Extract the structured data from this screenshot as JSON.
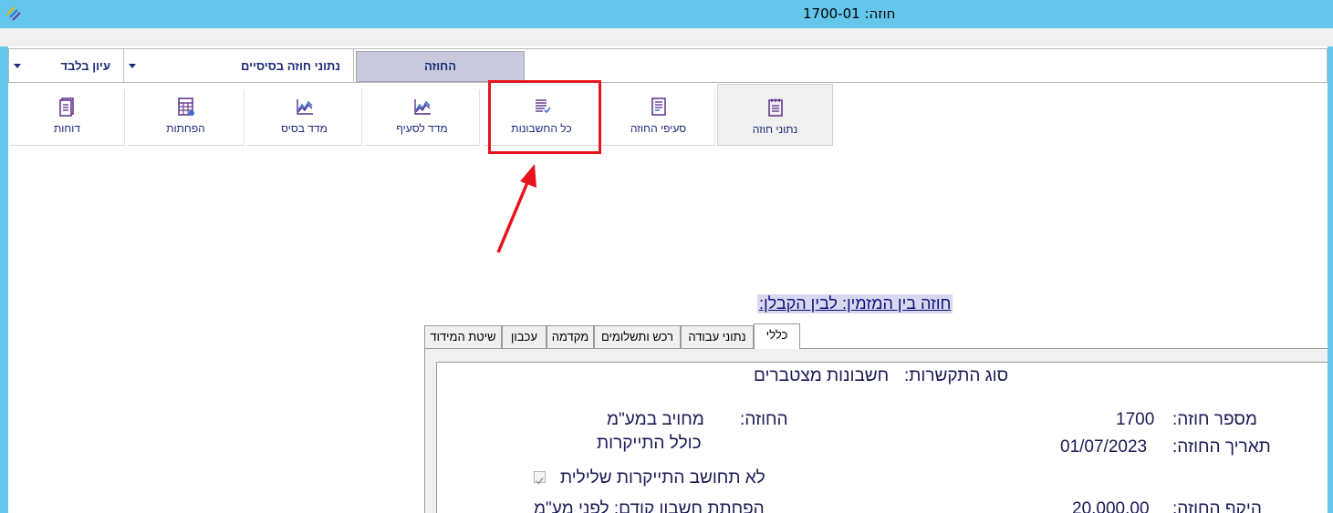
{
  "window": {
    "title": "חוזה: 1700-01"
  },
  "menubar": {
    "view_only": "עיון בלבד",
    "basic_data": "נתוני חוזה בסיסיים",
    "contract_tab": "החוזה"
  },
  "ribbon": {
    "items": [
      {
        "label": "נתוני חוזה",
        "icon": "contract-doc-icon",
        "active": true
      },
      {
        "label": "סעיפי החוזה",
        "icon": "clauses-doc-icon"
      },
      {
        "label": "כל החשבונות",
        "icon": "invoices-list-icon"
      },
      {
        "label": "מדד לסעיף",
        "icon": "line-chart-icon"
      },
      {
        "label": "מדד בסיס",
        "icon": "line-chart-icon"
      },
      {
        "label": "הפחתות",
        "icon": "calculator-icon"
      },
      {
        "label": "דוחות",
        "icon": "reports-icon"
      }
    ]
  },
  "annotation": {
    "highlight_color": "#e8141d"
  },
  "main": {
    "parties_title": "חוזה בין המזמין:   לבין הקבלן:"
  },
  "tabs": [
    "כללי",
    "נתוני עבודה",
    "רכש ותשלומים",
    "מקדמה",
    "עכבון",
    "שיטת המידוד"
  ],
  "general": {
    "link_type_label": "סוג התקשרות:",
    "link_type_value": "חשבונות מצטברים",
    "contract_no_label": "מספר חוזה:",
    "contract_no_value": "1700",
    "contract_date_label": "תאריך החוזה:",
    "contract_date_value": "01/07/2023",
    "contract_label": "החוזה:",
    "contract_value_1": "מחויב במע\"מ",
    "contract_value_2": "כולל התייקרות",
    "no_negative_indexation": "לא תחושב התייקרות שלילית",
    "scope_label": "היקף החוזה:",
    "scope_value": "20,000.00",
    "prev_deduction_label": "הפחתת חשבון קודם: לפני מע\"מ"
  },
  "colors": {
    "titlebar": "#63c6ea",
    "brand_text": "#1c2a7a",
    "tab_selected": "#c9c9dc"
  }
}
